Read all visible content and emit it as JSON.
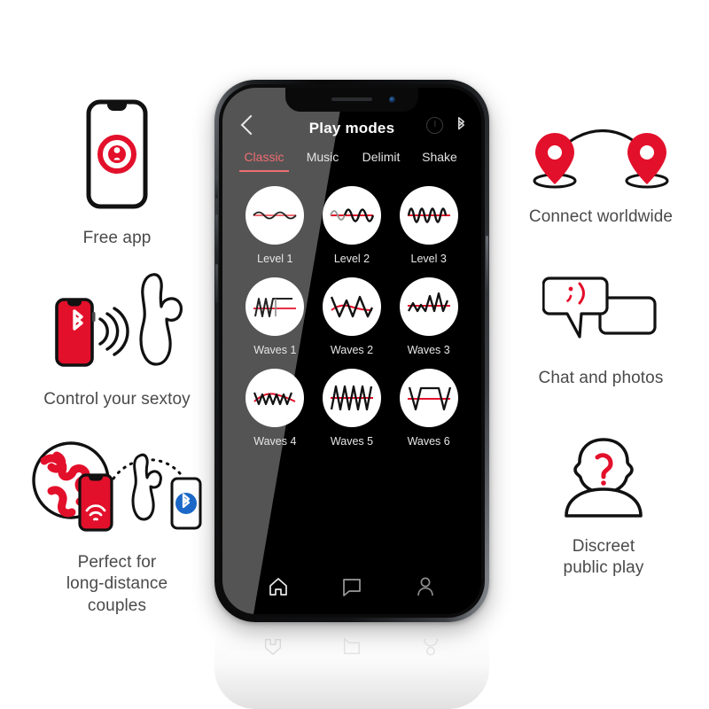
{
  "brand": {
    "red": "#e3102b",
    "accent_pink": "#ef6d72",
    "blue": "#1b68c8"
  },
  "features_left": [
    {
      "id": "free-app",
      "icon": "phone-with-lock-logo-icon",
      "caption": "Free app"
    },
    {
      "id": "control-sextoy",
      "icon": "phone-bluetooth-toy-icon",
      "caption": "Control your sextoy"
    },
    {
      "id": "long-distance",
      "icon": "globe-phones-toy-icon",
      "caption": "Perfect for\nlong-distance\ncouples"
    }
  ],
  "features_right": [
    {
      "id": "connect-worldwide",
      "icon": "two-map-pins-arc-icon",
      "caption": "Connect worldwide"
    },
    {
      "id": "chat-photos",
      "icon": "speech-bubbles-wink-icon",
      "caption": "Chat and photos"
    },
    {
      "id": "discreet-play",
      "icon": "anonymous-person-question-icon",
      "caption": "Discreet\npublic play"
    }
  ],
  "phone": {
    "header": {
      "back_icon": "chevron-left-icon",
      "title": "Play modes",
      "power_icon": "power-status-icon",
      "bluetooth_icon": "bluetooth-icon"
    },
    "tabs": [
      {
        "label": "Classic",
        "active": true
      },
      {
        "label": "Music",
        "active": false
      },
      {
        "label": "Delimit",
        "active": false
      },
      {
        "label": "Shake",
        "active": false
      }
    ],
    "modes": [
      {
        "label": "Level 1",
        "wave": "sine-low-amplitude"
      },
      {
        "label": "Level 2",
        "wave": "sine-medium"
      },
      {
        "label": "Level 3",
        "wave": "sine-high-frequency"
      },
      {
        "label": "Waves 1",
        "wave": "zigzag-then-flat"
      },
      {
        "label": "Waves 2",
        "wave": "triangle-peaks"
      },
      {
        "label": "Waves 3",
        "wave": "irregular-spikes"
      },
      {
        "label": "Waves 4",
        "wave": "small-zigzag-arc"
      },
      {
        "label": "Waves 5",
        "wave": "dense-triangle"
      },
      {
        "label": "Waves 6",
        "wave": "trapezoid-pulse"
      }
    ],
    "bottom_nav": [
      {
        "id": "home",
        "icon": "home-icon"
      },
      {
        "id": "chat",
        "icon": "chat-bubble-icon"
      },
      {
        "id": "profile",
        "icon": "person-icon"
      }
    ]
  }
}
